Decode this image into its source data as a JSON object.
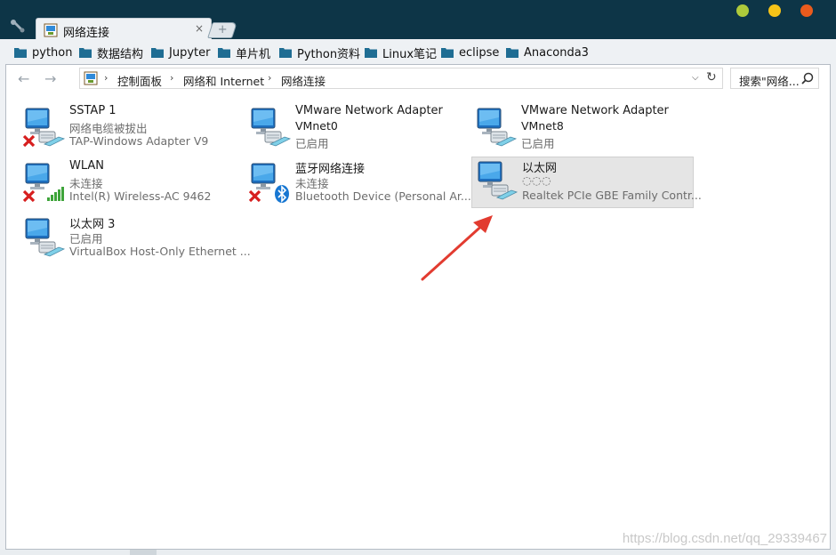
{
  "browser": {
    "tab_title": "网络连接",
    "tab_close": "×",
    "new_tab": "+",
    "traffic_colors": [
      "#aeca3b",
      "#f6c318",
      "#ea5b1d"
    ]
  },
  "bookmarks": [
    {
      "label": "python"
    },
    {
      "label": "数据结构"
    },
    {
      "label": "Jupyter"
    },
    {
      "label": "单片机"
    },
    {
      "label": "Python资料"
    },
    {
      "label": "Linux笔记"
    },
    {
      "label": "eclipse"
    },
    {
      "label": "Anaconda3"
    }
  ],
  "nav": {
    "back": "←",
    "forward": "→",
    "breadcrumb": [
      "控制面板",
      "网络和 Internet",
      "网络连接"
    ],
    "search_placeholder": "搜索\"网络..."
  },
  "items": [
    {
      "name": "SSTAP 1",
      "status": "网络电缆被拔出",
      "device": "TAP-Windows Adapter V9",
      "overlay": "red-x"
    },
    {
      "name": "VMware Network Adapter",
      "status": "VMnet0",
      "device": "已启用",
      "overlay": "none"
    },
    {
      "name": "VMware Network Adapter",
      "status": "VMnet8",
      "device": "已启用",
      "overlay": "none"
    },
    {
      "name": "WLAN",
      "status": "未连接",
      "device": "Intel(R) Wireless-AC 9462",
      "overlay": "red-x-wifi"
    },
    {
      "name": "蓝牙网络连接",
      "status": "未连接",
      "device": "Bluetooth Device (Personal Ar...",
      "overlay": "red-x-bluetooth"
    },
    {
      "name": "以太网",
      "status": "◌◌◌",
      "device": "Realtek PCIe GBE Family Contr...",
      "overlay": "none",
      "selected": true
    },
    {
      "name": "以太网 3",
      "status": "已启用",
      "device": "VirtualBox Host-Only Ethernet ...",
      "overlay": "none"
    }
  ],
  "watermark": "https://blog.csdn.net/qq_29339467"
}
